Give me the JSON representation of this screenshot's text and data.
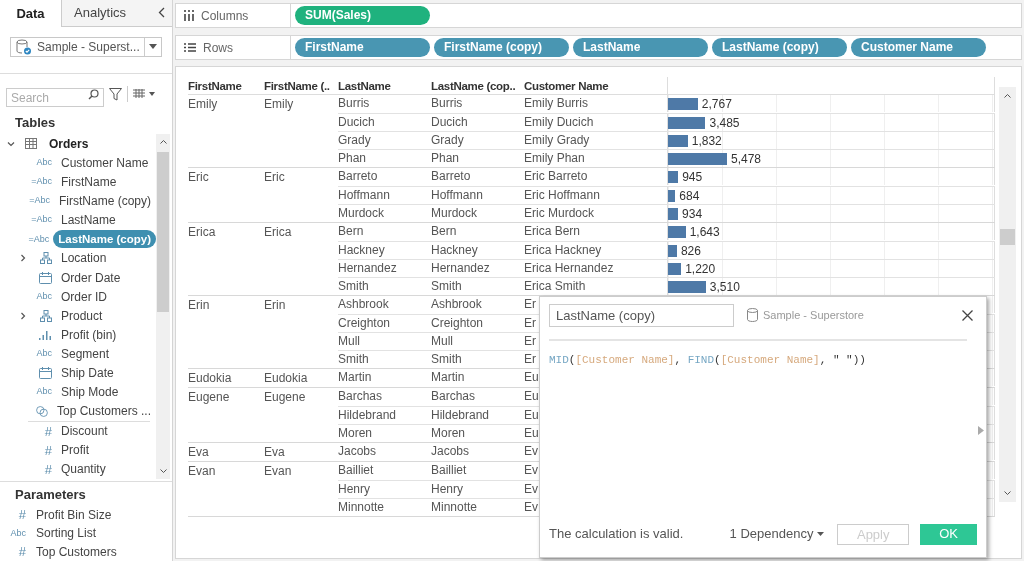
{
  "sidebar": {
    "tabs": [
      {
        "label": "Data",
        "selected": true
      },
      {
        "label": "Analytics",
        "selected": false
      }
    ],
    "datasource": "Sample - Superst...",
    "search": {
      "placeholder": "Search"
    },
    "tables_heading": "Tables",
    "tree": [
      {
        "label": "Orders",
        "kind": "table",
        "expanded": true,
        "selected": false,
        "children": [
          {
            "label": "Customer Name",
            "kind": "string",
            "type_label": "Abc",
            "selected": false
          },
          {
            "label": "FirstName",
            "kind": "string",
            "type_label": "=Abc",
            "selected": false
          },
          {
            "label": "FirstName (copy)",
            "kind": "string",
            "type_label": "=Abc",
            "selected": false
          },
          {
            "label": "LastName",
            "kind": "string",
            "type_label": "=Abc",
            "selected": false
          },
          {
            "label": "LastName (copy)",
            "kind": "string",
            "type_label": "=Abc",
            "selected": true
          },
          {
            "label": "Location",
            "kind": "hierarchy",
            "expanded": false,
            "selected": false
          },
          {
            "label": "Order Date",
            "kind": "date",
            "selected": false
          },
          {
            "label": "Order ID",
            "kind": "string",
            "type_label": "Abc",
            "selected": false
          },
          {
            "label": "Product",
            "kind": "hierarchy",
            "expanded": false,
            "selected": false
          },
          {
            "label": "Profit (bin)",
            "kind": "bin",
            "selected": false
          },
          {
            "label": "Segment",
            "kind": "string",
            "type_label": "Abc",
            "selected": false
          },
          {
            "label": "Ship Date",
            "kind": "date",
            "selected": false
          },
          {
            "label": "Ship Mode",
            "kind": "string",
            "type_label": "Abc",
            "selected": false
          },
          {
            "label": "Top Customers ...",
            "kind": "set",
            "selected": false
          },
          {
            "label": "Discount",
            "kind": "number",
            "type_label": "#",
            "selected": false
          },
          {
            "label": "Profit",
            "kind": "number",
            "type_label": "#",
            "selected": false
          },
          {
            "label": "Quantity",
            "kind": "number",
            "type_label": "#",
            "selected": false
          }
        ]
      }
    ],
    "parameters_heading": "Parameters",
    "parameters": [
      {
        "label": "Profit Bin Size",
        "kind": "number",
        "type_label": "#"
      },
      {
        "label": "Sorting List",
        "kind": "string",
        "type_label": "Abc"
      },
      {
        "label": "Top Customers",
        "kind": "number",
        "type_label": "#"
      }
    ]
  },
  "shelves": [
    {
      "label": "Columns",
      "kind": "columns",
      "pills": [
        {
          "label": "SUM(Sales)",
          "kind": "measure"
        }
      ]
    },
    {
      "label": "Rows",
      "kind": "rows",
      "pills": [
        {
          "label": "FirstName",
          "kind": "dimension"
        },
        {
          "label": "FirstName (copy)",
          "kind": "dimension"
        },
        {
          "label": "LastName",
          "kind": "dimension"
        },
        {
          "label": "LastName (copy)",
          "kind": "dimension"
        },
        {
          "label": "Customer Name",
          "kind": "dimension"
        }
      ]
    }
  ],
  "table": {
    "columns": [
      "FirstName",
      "FirstName (..",
      "LastName",
      "LastName (cop..",
      "Customer Name"
    ],
    "groups": [
      {
        "first_name": "Emily",
        "first_name_copy": "Emily",
        "rows": [
          {
            "last_name": "Burris",
            "last_name_copy": "Burris",
            "customer_name": "Emily Burris",
            "level": 0.0914,
            "sales": "2,767"
          },
          {
            "last_name": "Ducich",
            "last_name_copy": "Ducich",
            "customer_name": "Emily Ducich",
            "level": 0.115,
            "sales": "3,485"
          },
          {
            "last_name": "Grady",
            "last_name_copy": "Grady",
            "customer_name": "Emily Grady",
            "level": 0.0605,
            "sales": "1,832"
          },
          {
            "last_name": "Phan",
            "last_name_copy": "Phan",
            "customer_name": "Emily Phan",
            "level": 0.181,
            "sales": "5,478"
          }
        ]
      },
      {
        "first_name": "Eric",
        "first_name_copy": "Eric",
        "rows": [
          {
            "last_name": "Barreto",
            "last_name_copy": "Barreto",
            "customer_name": "Eric Barreto",
            "level": 0.0312,
            "sales": "945"
          },
          {
            "last_name": "Hoffmann",
            "last_name_copy": "Hoffmann",
            "customer_name": "Eric Hoffmann",
            "level": 0.0226,
            "sales": "684"
          },
          {
            "last_name": "Murdock",
            "last_name_copy": "Murdock",
            "customer_name": "Eric Murdock",
            "level": 0.0309,
            "sales": "934"
          }
        ]
      },
      {
        "first_name": "Erica",
        "first_name_copy": "Erica",
        "rows": [
          {
            "last_name": "Bern",
            "last_name_copy": "Bern",
            "customer_name": "Erica Bern",
            "level": 0.0543,
            "sales": "1,643"
          },
          {
            "last_name": "Hackney",
            "last_name_copy": "Hackney",
            "customer_name": "Erica Hackney",
            "level": 0.0273,
            "sales": "826"
          },
          {
            "last_name": "Hernandez",
            "last_name_copy": "Hernandez",
            "customer_name": "Erica Hernandez",
            "level": 0.0403,
            "sales": "1,220"
          },
          {
            "last_name": "Smith",
            "last_name_copy": "Smith",
            "customer_name": "Erica Smith",
            "level": 0.116,
            "sales": "3,510"
          }
        ]
      },
      {
        "first_name": "Erin",
        "first_name_copy": "Erin",
        "rows": [
          {
            "last_name": "Ashbrook",
            "last_name_copy": "Ashbrook",
            "customer_name": "Er"
          },
          {
            "last_name": "Creighton",
            "last_name_copy": "Creighton",
            "customer_name": "Er"
          },
          {
            "last_name": "Mull",
            "last_name_copy": "Mull",
            "customer_name": "Er"
          },
          {
            "last_name": "Smith",
            "last_name_copy": "Smith",
            "customer_name": "Er"
          }
        ]
      },
      {
        "first_name": "Eudokia",
        "first_name_copy": "Eudokia",
        "rows": [
          {
            "last_name": "Martin",
            "last_name_copy": "Martin",
            "customer_name": "Eu"
          }
        ]
      },
      {
        "first_name": "Eugene",
        "first_name_copy": "Eugene",
        "rows": [
          {
            "last_name": "Barchas",
            "last_name_copy": "Barchas",
            "customer_name": "Eu"
          },
          {
            "last_name": "Hildebrand",
            "last_name_copy": "Hildebrand",
            "customer_name": "Eu"
          },
          {
            "last_name": "Moren",
            "last_name_copy": "Moren",
            "customer_name": "Eu"
          }
        ]
      },
      {
        "first_name": "Eva",
        "first_name_copy": "Eva",
        "rows": [
          {
            "last_name": "Jacobs",
            "last_name_copy": "Jacobs",
            "customer_name": "Ev"
          }
        ]
      },
      {
        "first_name": "Evan",
        "first_name_copy": "Evan",
        "rows": [
          {
            "last_name": "Bailliet",
            "last_name_copy": "Bailliet",
            "customer_name": "Ev"
          },
          {
            "last_name": "Henry",
            "last_name_copy": "Henry",
            "customer_name": "Ev"
          },
          {
            "last_name": "Minnotte",
            "last_name_copy": "Minnotte",
            "customer_name": "Ev"
          }
        ]
      }
    ]
  },
  "calc_dialog": {
    "name": "LastName (copy)",
    "datasource": "Sample - Superstore",
    "formula": [
      {
        "kind": "function",
        "text": "MID"
      },
      {
        "kind": "punct",
        "text": "("
      },
      {
        "kind": "field",
        "text": "[Customer Name]"
      },
      {
        "kind": "punct",
        "text": ", "
      },
      {
        "kind": "function",
        "text": "FIND"
      },
      {
        "kind": "punct",
        "text": "("
      },
      {
        "kind": "field",
        "text": "[Customer Name]"
      },
      {
        "kind": "punct",
        "text": ", "
      },
      {
        "kind": "string",
        "text": "\" \""
      },
      {
        "kind": "punct",
        "text": "))"
      }
    ],
    "status": "The calculation is valid.",
    "dependency": "1 Dependency",
    "buttons": [
      {
        "label": "Apply",
        "kind": "secondary",
        "disabled": true
      },
      {
        "label": "OK",
        "kind": "primary",
        "disabled": false
      }
    ]
  }
}
